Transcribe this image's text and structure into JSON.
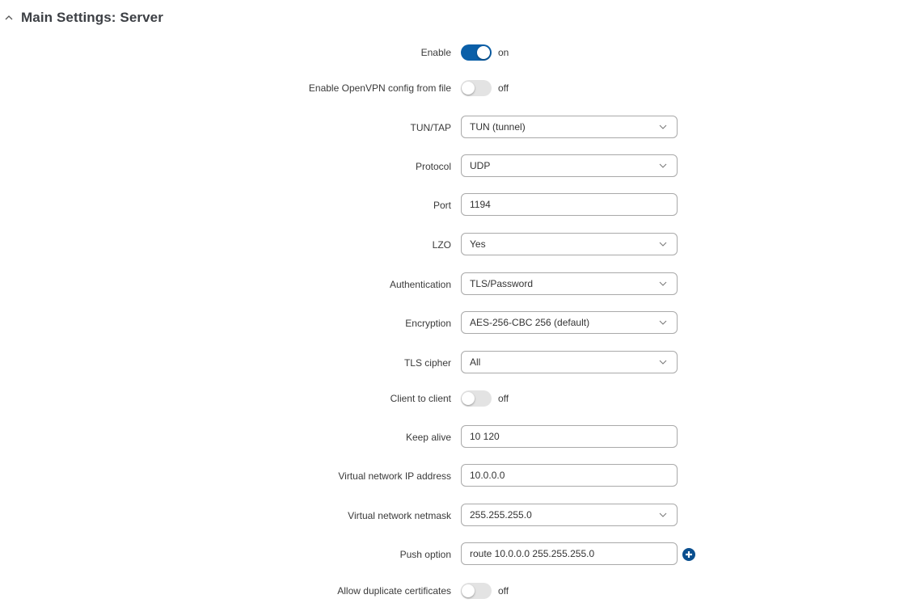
{
  "section": {
    "title": "Main Settings: Server",
    "collapse_icon": "chevron-up-icon"
  },
  "colors": {
    "accent": "#0a5fa8",
    "add_button": "#0a4f8f",
    "toggle_off": "#e3e3e3"
  },
  "fields": [
    {
      "key": "enable",
      "label": "Enable",
      "type": "toggle",
      "value": "on"
    },
    {
      "key": "config_from_file",
      "label": "Enable OpenVPN config from file",
      "type": "toggle",
      "value": "off"
    },
    {
      "key": "tun_tap",
      "label": "TUN/TAP",
      "type": "select",
      "value": "TUN (tunnel)"
    },
    {
      "key": "protocol",
      "label": "Protocol",
      "type": "select",
      "value": "UDP"
    },
    {
      "key": "port",
      "label": "Port",
      "type": "input",
      "value": "1194"
    },
    {
      "key": "lzo",
      "label": "LZO",
      "type": "select",
      "value": "Yes"
    },
    {
      "key": "authentication",
      "label": "Authentication",
      "type": "select",
      "value": "TLS/Password"
    },
    {
      "key": "encryption",
      "label": "Encryption",
      "type": "select",
      "value": "AES-256-CBC 256 (default)"
    },
    {
      "key": "tls_cipher",
      "label": "TLS cipher",
      "type": "select",
      "value": "All"
    },
    {
      "key": "client_to_client",
      "label": "Client to client",
      "type": "toggle",
      "value": "off"
    },
    {
      "key": "keep_alive",
      "label": "Keep alive",
      "type": "input",
      "value": "10 120"
    },
    {
      "key": "vnet_ip",
      "label": "Virtual network IP address",
      "type": "input",
      "value": "10.0.0.0"
    },
    {
      "key": "vnet_netmask",
      "label": "Virtual network netmask",
      "type": "select",
      "value": "255.255.255.0"
    },
    {
      "key": "push_option",
      "label": "Push option",
      "type": "input",
      "value": "route 10.0.0.0 255.255.255.0",
      "add_icon": "plus-circle-icon"
    },
    {
      "key": "allow_dup_certs",
      "label": "Allow duplicate certificates",
      "type": "toggle",
      "value": "off"
    }
  ]
}
